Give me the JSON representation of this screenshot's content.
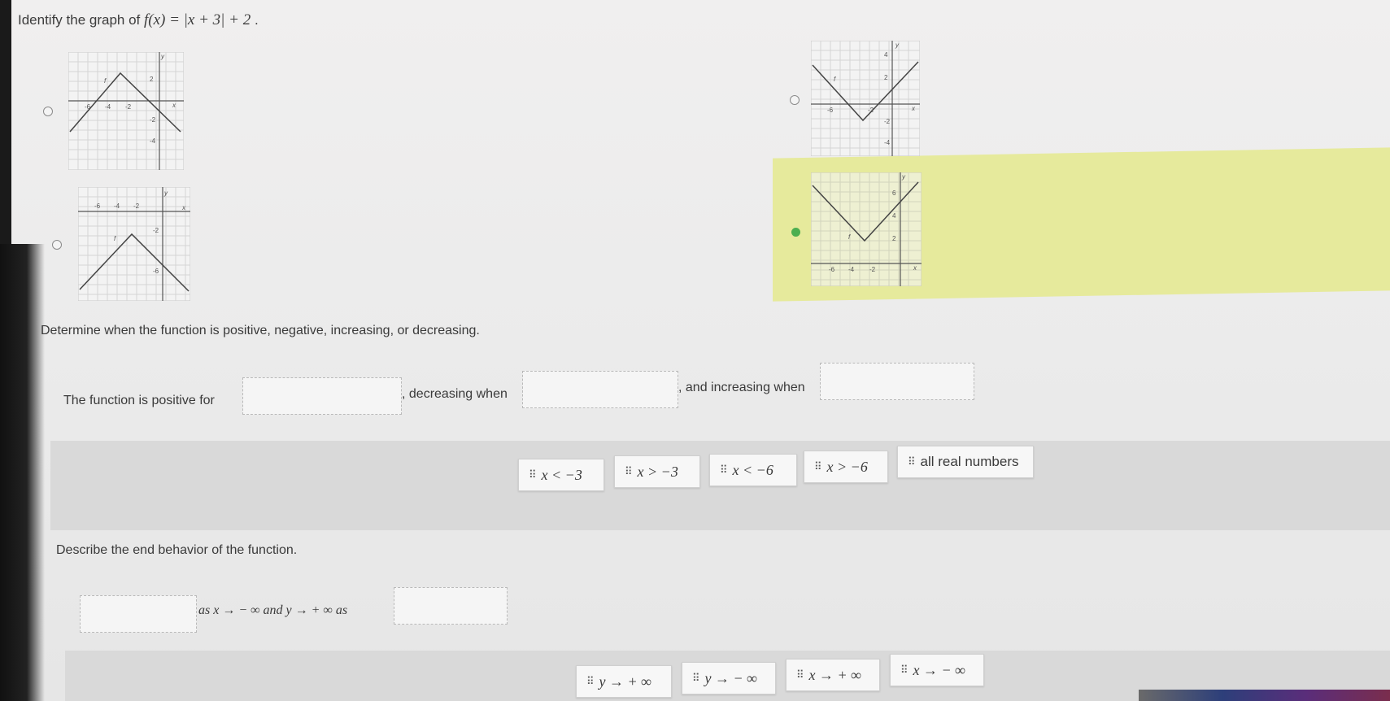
{
  "question": {
    "prefix": "Identify the graph of ",
    "math": "f(x) = |x + 3| + 2",
    "suffix": " ."
  },
  "graphs": [
    {
      "selected": false,
      "tick_labels_x": [
        "-6",
        "-4",
        "-2",
        "x"
      ],
      "tick_labels_y": [
        "y",
        "2",
        "-2",
        "-4"
      ],
      "curve_label": "f"
    },
    {
      "selected": false,
      "tick_labels_x": [
        "-6",
        "-2",
        "x"
      ],
      "tick_labels_y": [
        "y",
        "4",
        "2",
        "-2",
        "-4"
      ],
      "curve_label": "f"
    },
    {
      "selected": false,
      "tick_labels_x": [
        "-6",
        "-4",
        "-2",
        "x"
      ],
      "tick_labels_y": [
        "y",
        "-2",
        "-6"
      ],
      "curve_label": "f"
    },
    {
      "selected": true,
      "tick_labels_x": [
        "-6",
        "-4",
        "-2",
        "x"
      ],
      "tick_labels_y": [
        "y",
        "6",
        "4",
        "2"
      ],
      "curve_label": "f"
    }
  ],
  "colors": {
    "selected_radio": "#4caf50",
    "highlight": "#e6ea9c"
  },
  "determine": {
    "prompt": "Determine when the function is positive, negative, increasing, or decreasing.",
    "positive_label": "The function is positive for",
    "decreasing_label": ", decreasing when",
    "increasing_label": ", and increasing when",
    "positive_value": "",
    "decreasing_value": "",
    "increasing_value": ""
  },
  "chips1": [
    "x < −3",
    "x > −3",
    "x < −6",
    "x > −6",
    "all real numbers"
  ],
  "end_behavior": {
    "prompt": "Describe the end behavior of the function.",
    "text1": "as x → − ∞ and y → + ∞ as",
    "value1": "",
    "value2": ""
  },
  "chips2": [
    "y → + ∞",
    "y → − ∞",
    "x → + ∞",
    "x → − ∞"
  ]
}
